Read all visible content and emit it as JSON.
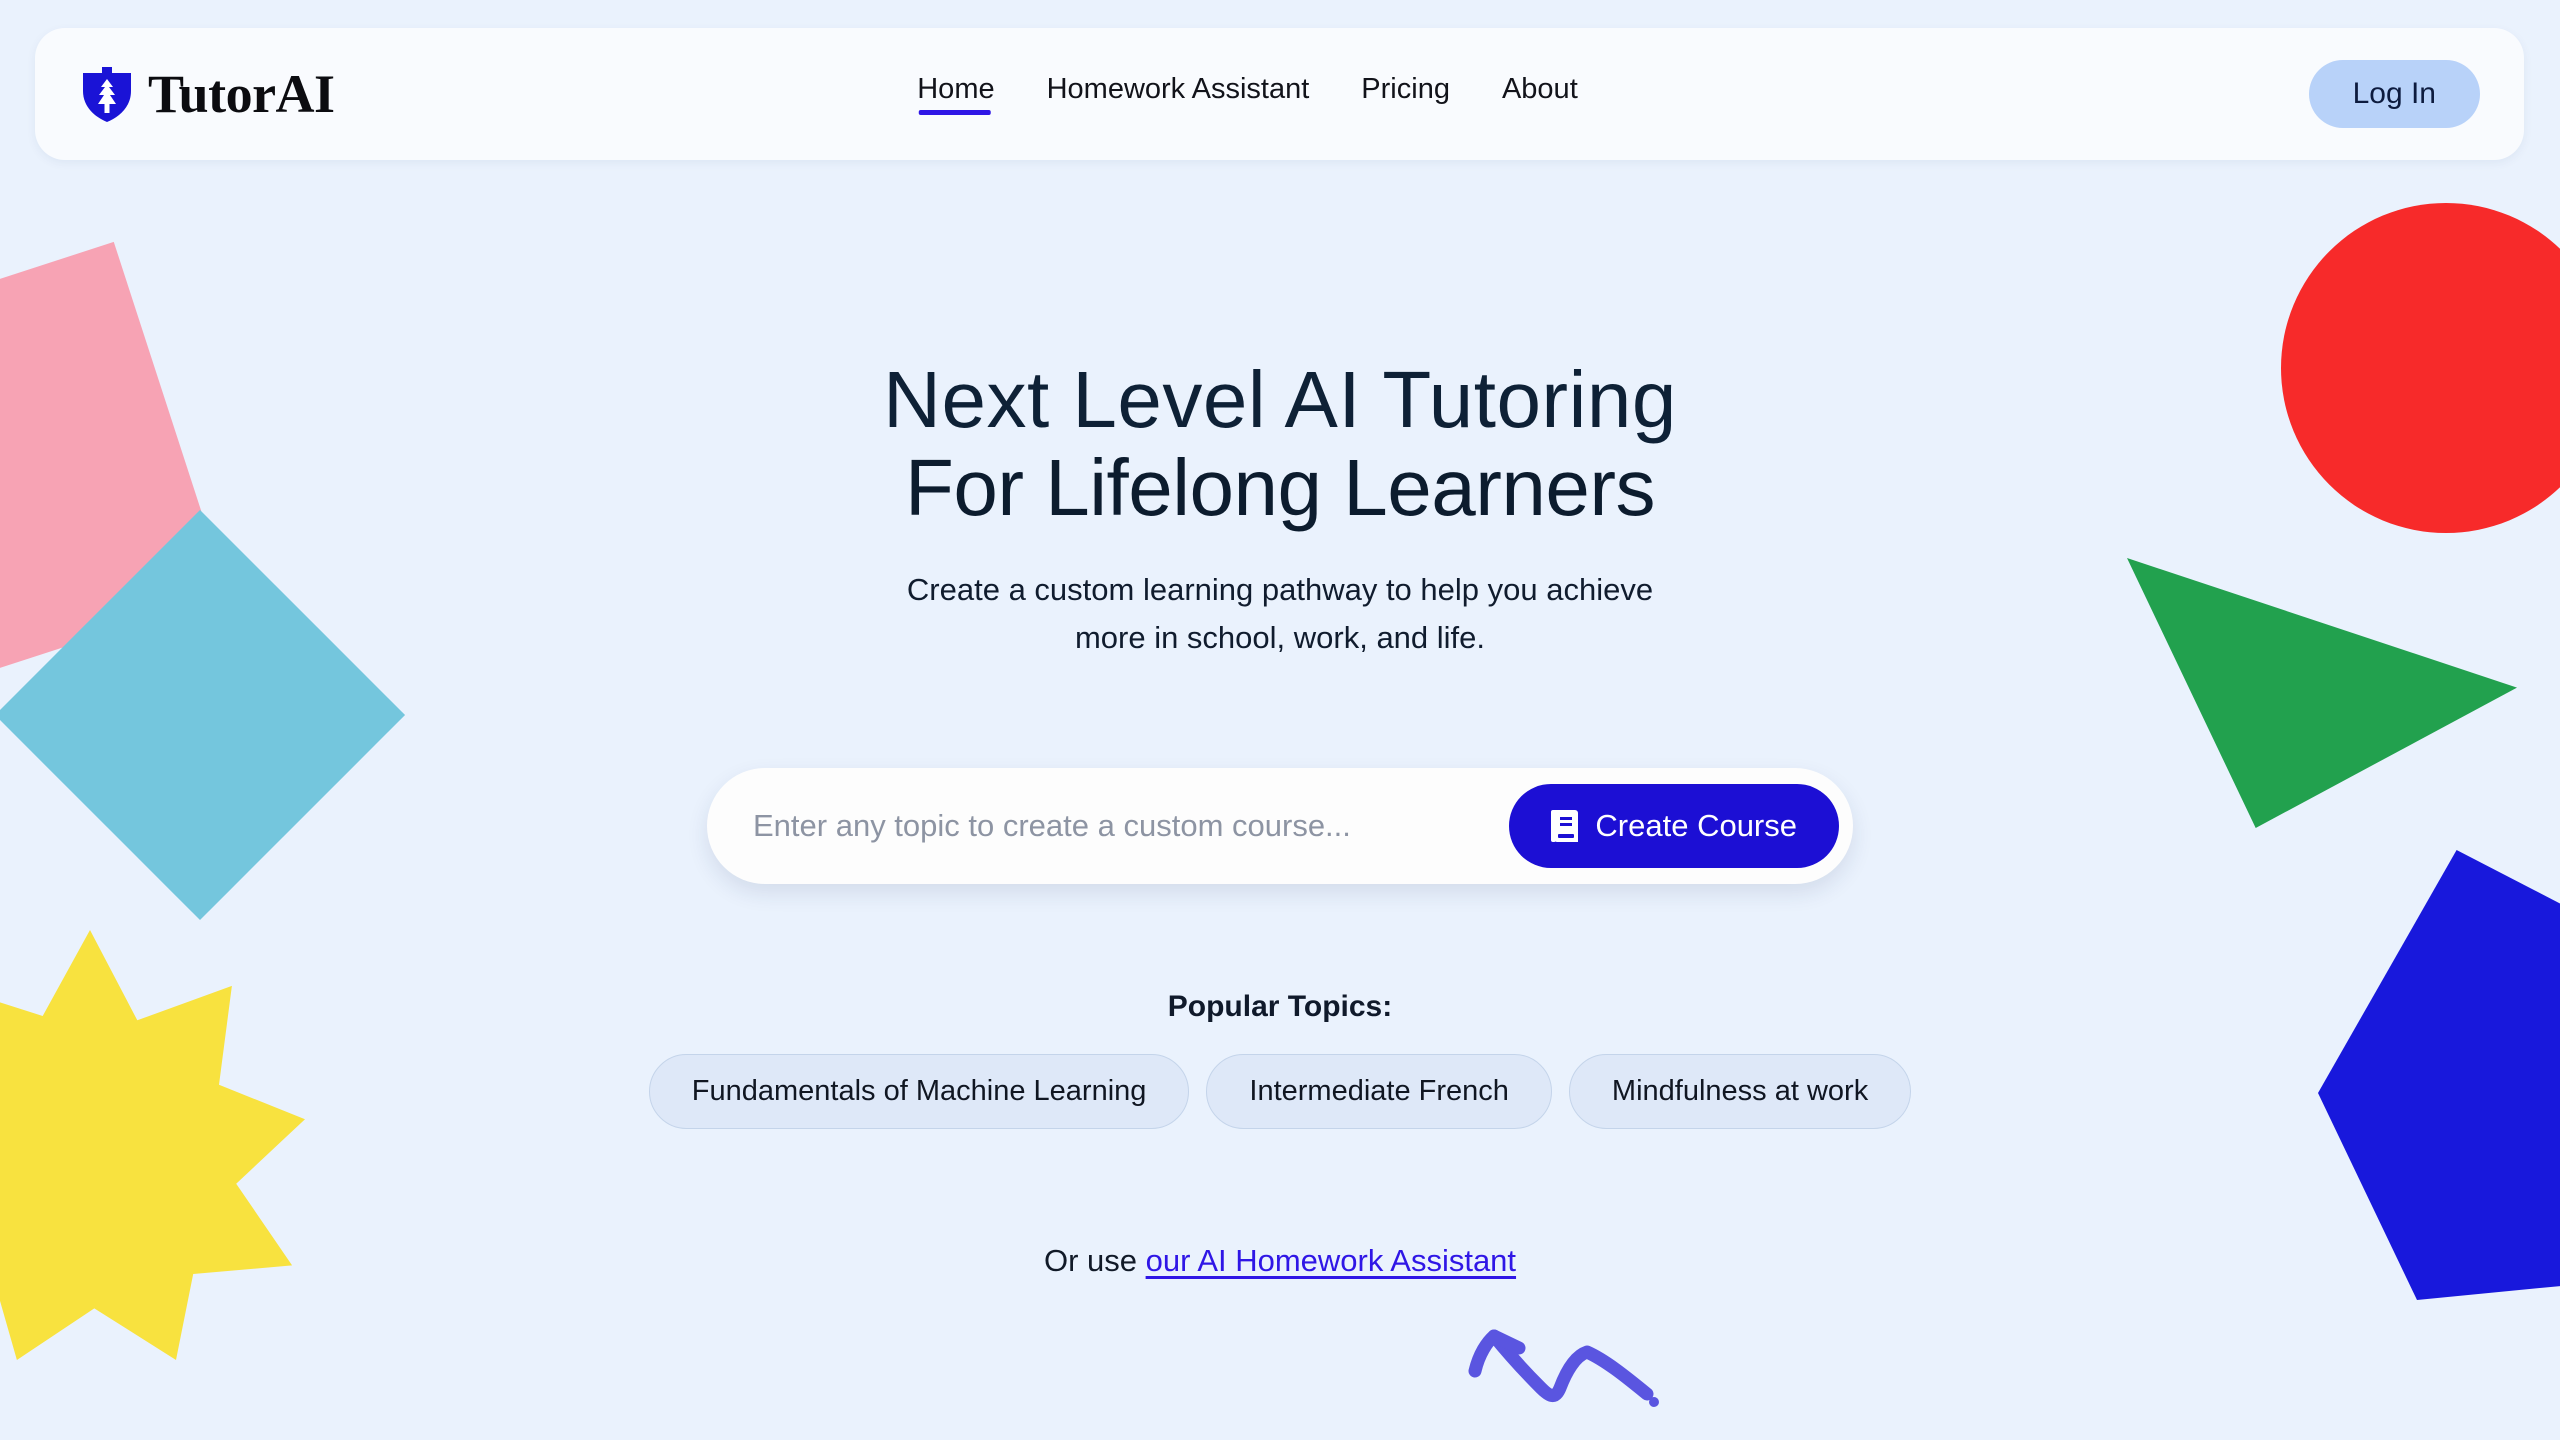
{
  "brand": {
    "name": "TutorAI",
    "logo_icon": "shield-tree-icon",
    "logo_color": "#1a13d6"
  },
  "nav": {
    "items": [
      {
        "label": "Home",
        "active": true
      },
      {
        "label": "Homework Assistant",
        "active": false
      },
      {
        "label": "Pricing",
        "active": false
      },
      {
        "label": "About",
        "active": false
      }
    ],
    "active_underline_color": "#2f16e6"
  },
  "header": {
    "login_label": "Log In",
    "login_bg": "#b8d2f9"
  },
  "hero": {
    "headline_line1": "Next Level AI Tutoring",
    "headline_line2": "For Lifelong Learners",
    "subtitle_line1": "Create a custom learning pathway to help you achieve",
    "subtitle_line2": "more in school, work, and life."
  },
  "search": {
    "placeholder": "Enter any topic to create a custom course...",
    "value": "",
    "button_label": "Create Course",
    "button_icon": "book-icon",
    "button_bg": "#1c0fd4"
  },
  "topics": {
    "label": "Popular Topics:",
    "items": [
      {
        "label": "Fundamentals of Machine Learning"
      },
      {
        "label": "Intermediate French"
      },
      {
        "label": "Mindfulness at work"
      }
    ],
    "pill_bg": "#dee8f8"
  },
  "homework": {
    "prefix": "Or use ",
    "link_label": "our AI Homework Assistant",
    "link_color": "#2f16e6",
    "arrow_icon": "squiggle-arrow-icon",
    "arrow_color": "#5a55e0"
  },
  "decorations": {
    "background_color": "#eaf2fd",
    "shapes": [
      {
        "name": "pink-quadrilateral",
        "color": "#f7a3b4"
      },
      {
        "name": "cyan-diamond",
        "color": "#74c6dd"
      },
      {
        "name": "yellow-starburst",
        "color": "#f8e23f"
      },
      {
        "name": "red-circle",
        "color": "#f72a2a"
      },
      {
        "name": "green-triangle",
        "color": "#22a14e"
      },
      {
        "name": "blue-pentagon",
        "color": "#1818dc"
      }
    ]
  }
}
